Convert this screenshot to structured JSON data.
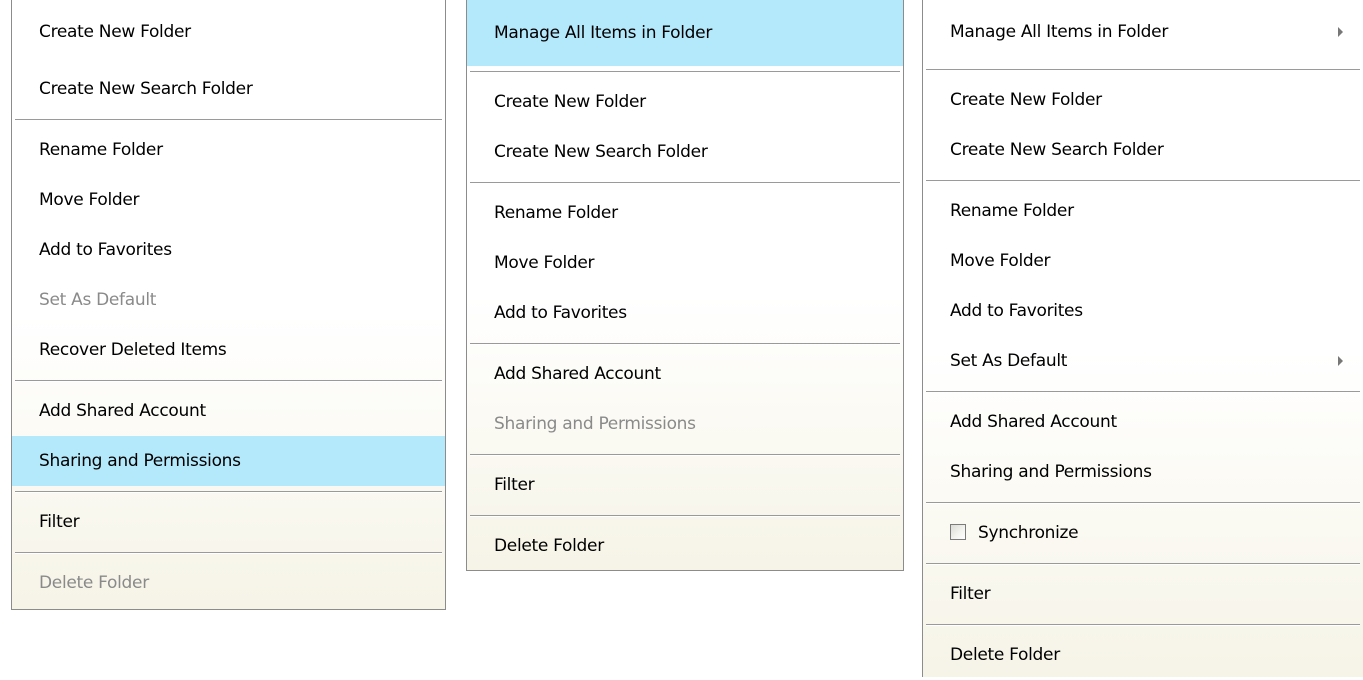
{
  "menu_a": {
    "items": [
      {
        "label": "Create New Folder"
      },
      {
        "label": "Create New Search Folder"
      },
      {
        "label": "Rename Folder"
      },
      {
        "label": "Move Folder"
      },
      {
        "label": "Add to Favorites"
      },
      {
        "label": "Set As Default",
        "state": "disabled"
      },
      {
        "label": "Recover Deleted Items"
      },
      {
        "label": "Add Shared Account"
      },
      {
        "label": "Sharing and Permissions",
        "state": "highlighted"
      },
      {
        "label": "Filter"
      },
      {
        "label": "Delete Folder",
        "state": "disabled"
      }
    ]
  },
  "menu_b": {
    "items": [
      {
        "label": "Manage All Items in Folder",
        "state": "highlighted"
      },
      {
        "label": "Create New Folder"
      },
      {
        "label": "Create New Search Folder"
      },
      {
        "label": "Rename Folder"
      },
      {
        "label": "Move Folder"
      },
      {
        "label": "Add to Favorites"
      },
      {
        "label": "Add Shared Account"
      },
      {
        "label": "Sharing and Permissions",
        "state": "disabled"
      },
      {
        "label": "Filter"
      },
      {
        "label": "Delete Folder"
      }
    ]
  },
  "menu_c": {
    "items": [
      {
        "label": "Manage All Items in Folder",
        "submenu": true
      },
      {
        "label": "Create New Folder"
      },
      {
        "label": "Create New Search Folder"
      },
      {
        "label": "Rename Folder"
      },
      {
        "label": "Move Folder"
      },
      {
        "label": "Add to Favorites"
      },
      {
        "label": "Set As Default",
        "submenu": true
      },
      {
        "label": "Add Shared Account"
      },
      {
        "label": "Sharing and Permissions"
      },
      {
        "label": "Synchronize",
        "checkbox": true,
        "checked": false
      },
      {
        "label": "Filter"
      },
      {
        "label": "Delete Folder"
      }
    ]
  },
  "colors": {
    "highlight": "#b4e8fb",
    "disabled_text": "#8a8a8a",
    "separator": "#9a9a9a"
  }
}
